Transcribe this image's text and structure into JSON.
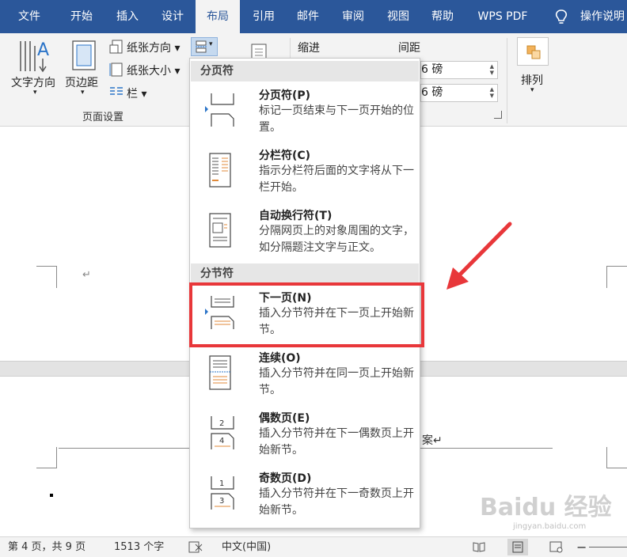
{
  "tabs": [
    {
      "label": "文件",
      "active": false
    },
    {
      "label": "开始",
      "active": false
    },
    {
      "label": "插入",
      "active": false
    },
    {
      "label": "设计",
      "active": false
    },
    {
      "label": "布局",
      "active": true
    },
    {
      "label": "引用",
      "active": false
    },
    {
      "label": "邮件",
      "active": false
    },
    {
      "label": "审阅",
      "active": false
    },
    {
      "label": "视图",
      "active": false
    },
    {
      "label": "帮助",
      "active": false
    },
    {
      "label": "WPS PDF",
      "active": false
    }
  ],
  "assist_label": "操作说明",
  "ribbon": {
    "text_direction": "文字方向",
    "margins": "页边距",
    "orientation": "纸张方向",
    "size": "纸张大小",
    "columns": "栏",
    "group_label": "页面设置",
    "indent_label": "缩进",
    "spacing_label": "间距",
    "spacing_before": "6 磅",
    "spacing_after": "6 磅",
    "arrange": "排列"
  },
  "menu": {
    "page_breaks_header": "分页符",
    "section_breaks_header": "分节符",
    "items": [
      {
        "title": "分页符(P)",
        "desc": "标记一页结束与下一页开始的位置。"
      },
      {
        "title": "分栏符(C)",
        "desc": "指示分栏符后面的文字将从下一栏开始。"
      },
      {
        "title": "自动换行符(T)",
        "desc": "分隔网页上的对象周围的文字，如分隔题注文字与正文。"
      },
      {
        "title": "下一页(N)",
        "desc": "插入分节符并在下一页上开始新节。"
      },
      {
        "title": "连续(O)",
        "desc": "插入分节符并在同一页上开始新节。"
      },
      {
        "title": "偶数页(E)",
        "desc": "插入分节符并在下一偶数页上开始新节。"
      },
      {
        "title": "奇数页(D)",
        "desc": "插入分节符并在下一奇数页上开始新节。"
      }
    ]
  },
  "document": {
    "para_mark": "↵",
    "partial_text": "案↵"
  },
  "status": {
    "page": "第 4 页，共 9 页",
    "words": "1513 个字",
    "language": "中文(中国)"
  },
  "watermark": {
    "text": "Baidu 经验",
    "url": "jingyan.baidu.com"
  },
  "colors": {
    "brand": "#2b579a",
    "highlight": "#e8373a"
  }
}
